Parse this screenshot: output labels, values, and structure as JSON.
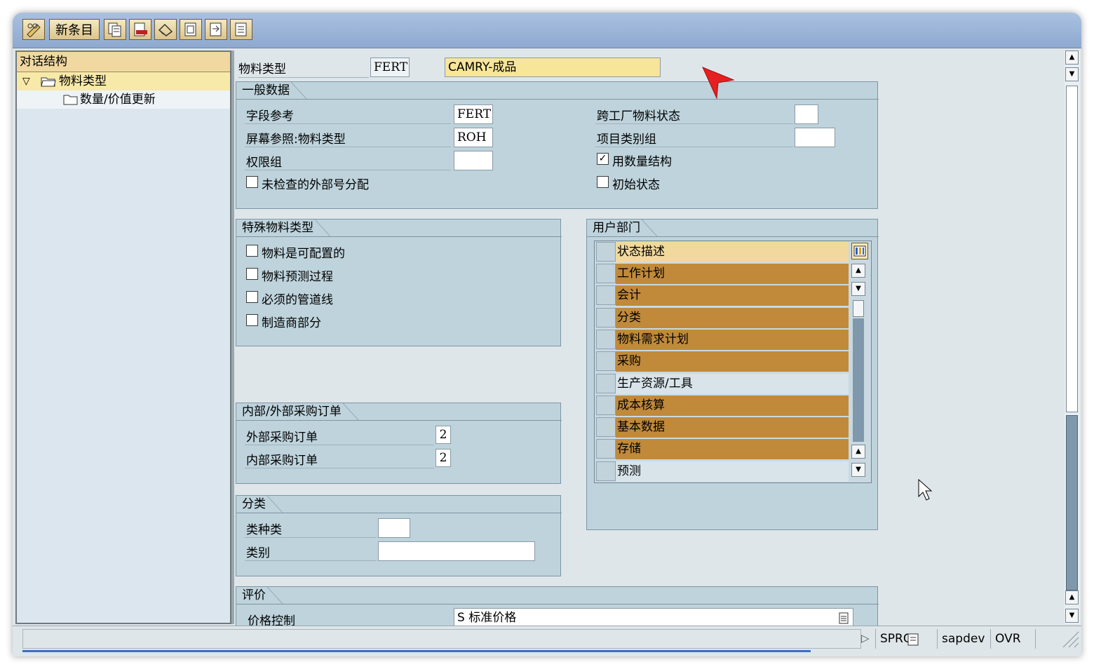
{
  "toolbar": {
    "new_entries_label": "新条目"
  },
  "tree": {
    "header": "对话结构",
    "items": [
      {
        "label": "物料类型"
      },
      {
        "label": "数量/价值更新"
      }
    ]
  },
  "header": {
    "matl_type_label": "物料类型",
    "matl_type_code": "FERT",
    "matl_type_desc": "CAMRY-成品"
  },
  "general": {
    "title": "一般数据",
    "field_ref_label": "字段参考",
    "field_ref_value": "FERT",
    "screen_ref_label": "屏幕参照:物料类型",
    "screen_ref_value": "ROH",
    "auth_group_label": "权限组",
    "auth_group_value": "",
    "unchecked_ext_label": "未检查的外部号分配",
    "cross_plant_label": "跨工厂物料状态",
    "cross_plant_value": "",
    "item_cat_label": "项目类别组",
    "item_cat_value": "",
    "qty_struct_label": "用数量结构",
    "initial_status_label": "初始状态"
  },
  "special": {
    "title": "特殊物料类型",
    "items": [
      "物料是可配置的",
      "物料预测过程",
      "必须的管道线",
      "制造商部分"
    ]
  },
  "purchase": {
    "title": "内部/外部采购订单",
    "external_label": "外部采购订单",
    "external_value": "2",
    "internal_label": "内部采购订单",
    "internal_value": "2"
  },
  "classification": {
    "title": "分类",
    "class_type_label": "类种类",
    "class_type_value": "",
    "class_label": "类别",
    "class_value": ""
  },
  "valuation": {
    "title": "评价",
    "price_control_label": "价格控制",
    "price_control_value": "S 标准价格"
  },
  "user_dept": {
    "title": "用户部门",
    "column_header": "状态描述",
    "rows": [
      {
        "label": "工作计划",
        "selected": true
      },
      {
        "label": "会计",
        "selected": true
      },
      {
        "label": "分类",
        "selected": true
      },
      {
        "label": "物料需求计划",
        "selected": true
      },
      {
        "label": "采购",
        "selected": true
      },
      {
        "label": "生产资源/工具",
        "selected": false
      },
      {
        "label": "成本核算",
        "selected": true
      },
      {
        "label": "基本数据",
        "selected": true
      },
      {
        "label": "存储",
        "selected": true
      },
      {
        "label": "预测",
        "selected": false
      }
    ]
  },
  "statusbar": {
    "transaction": "SPRO",
    "system": "sapdev",
    "mode": "OVR"
  },
  "colors": {
    "row_selected": "#c08a3a",
    "group_bg": "#bed3dc",
    "field_highlight": "#f7e59a"
  }
}
